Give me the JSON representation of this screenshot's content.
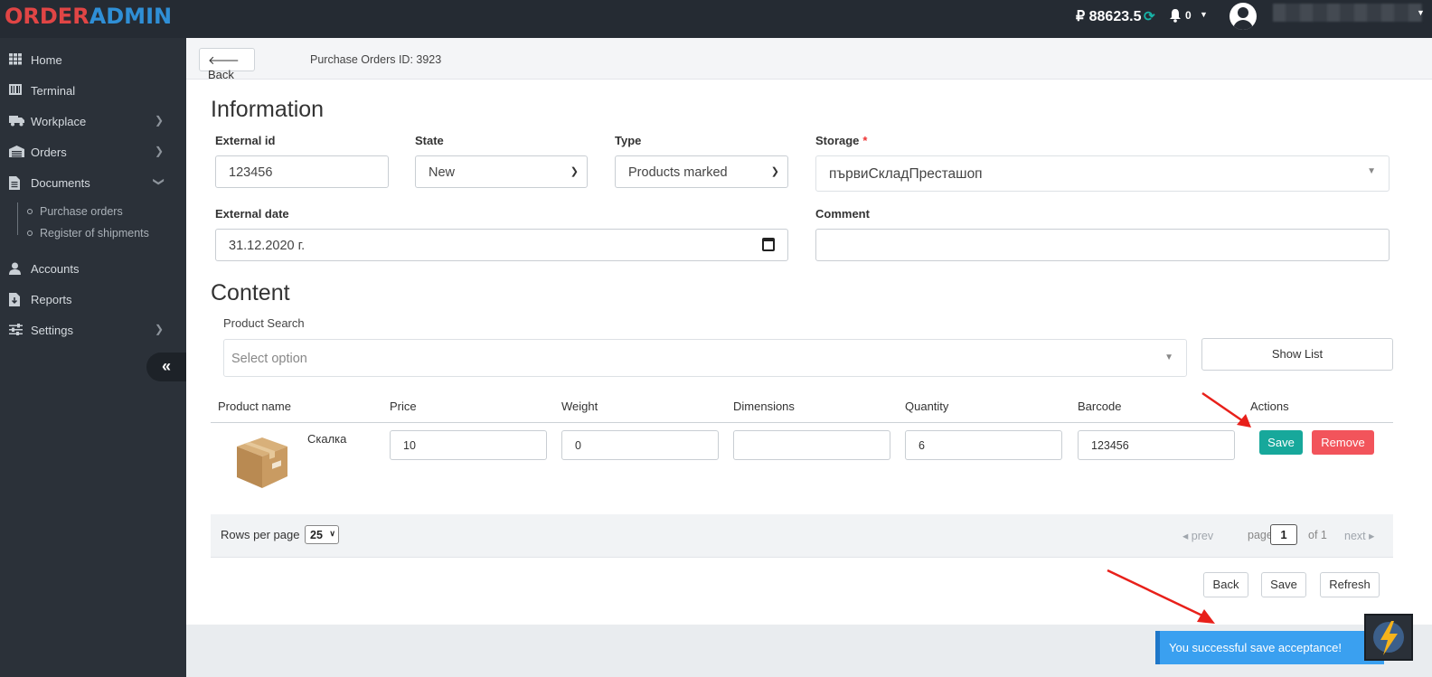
{
  "brand": {
    "part1": "ORDER",
    "part2": "ADMIN",
    "color1": "#e04545",
    "color2": "#2f8fd6"
  },
  "header": {
    "balance": "₽ 88623.5",
    "notifications_count": "0"
  },
  "sidebar": {
    "items": [
      {
        "label": "Home",
        "icon": "grid-icon"
      },
      {
        "label": "Terminal",
        "icon": "terminal-icon"
      },
      {
        "label": "Workplace",
        "icon": "truck-icon"
      },
      {
        "label": "Orders",
        "icon": "warehouse-icon"
      },
      {
        "label": "Documents",
        "icon": "file-icon"
      },
      {
        "label": "Accounts",
        "icon": "user-icon"
      },
      {
        "label": "Reports",
        "icon": "report-icon"
      },
      {
        "label": "Settings",
        "icon": "sliders-icon"
      }
    ],
    "documents_sub": [
      "Purchase orders",
      "Register of shipments"
    ]
  },
  "page": {
    "back_label": "Back",
    "title": "Purchase Orders ID: 3923"
  },
  "information": {
    "heading": "Information",
    "external_id": {
      "label": "External id",
      "value": "123456"
    },
    "state": {
      "label": "State",
      "value": "New"
    },
    "type": {
      "label": "Type",
      "value": "Products marked"
    },
    "storage": {
      "label": "Storage",
      "required": "*",
      "value": "първиСкладПресташоп"
    },
    "external_date": {
      "label": "External date",
      "value": "31.12.2020 г."
    },
    "comment": {
      "label": "Comment",
      "value": ""
    }
  },
  "content": {
    "heading": "Content",
    "product_search_label": "Product Search",
    "product_search_placeholder": "Select option",
    "show_list": "Show List",
    "columns": [
      "Product name",
      "Price",
      "Weight",
      "Dimensions",
      "Quantity",
      "Barcode",
      "Actions"
    ],
    "rows": [
      {
        "name": "Скалка",
        "price": "10",
        "weight": "0",
        "dimensions": "",
        "quantity": "6",
        "barcode": "123456",
        "save": "Save",
        "remove": "Remove"
      }
    ],
    "pagination": {
      "rows_per_page_label": "Rows per page",
      "rows_per_page": "25",
      "prev": "prev",
      "page_label": "page",
      "page": "1",
      "of": "of 1",
      "next": "next"
    }
  },
  "footer_buttons": {
    "back": "Back",
    "save": "Save",
    "refresh": "Refresh"
  },
  "toast": {
    "message": "You successful save acceptance!"
  },
  "colors": {
    "sidebar_bg": "#2b3139",
    "topbar_bg": "#252b33",
    "save_green": "#17a89b",
    "remove_red": "#f2545b",
    "toast_blue": "#3aa0f0"
  }
}
